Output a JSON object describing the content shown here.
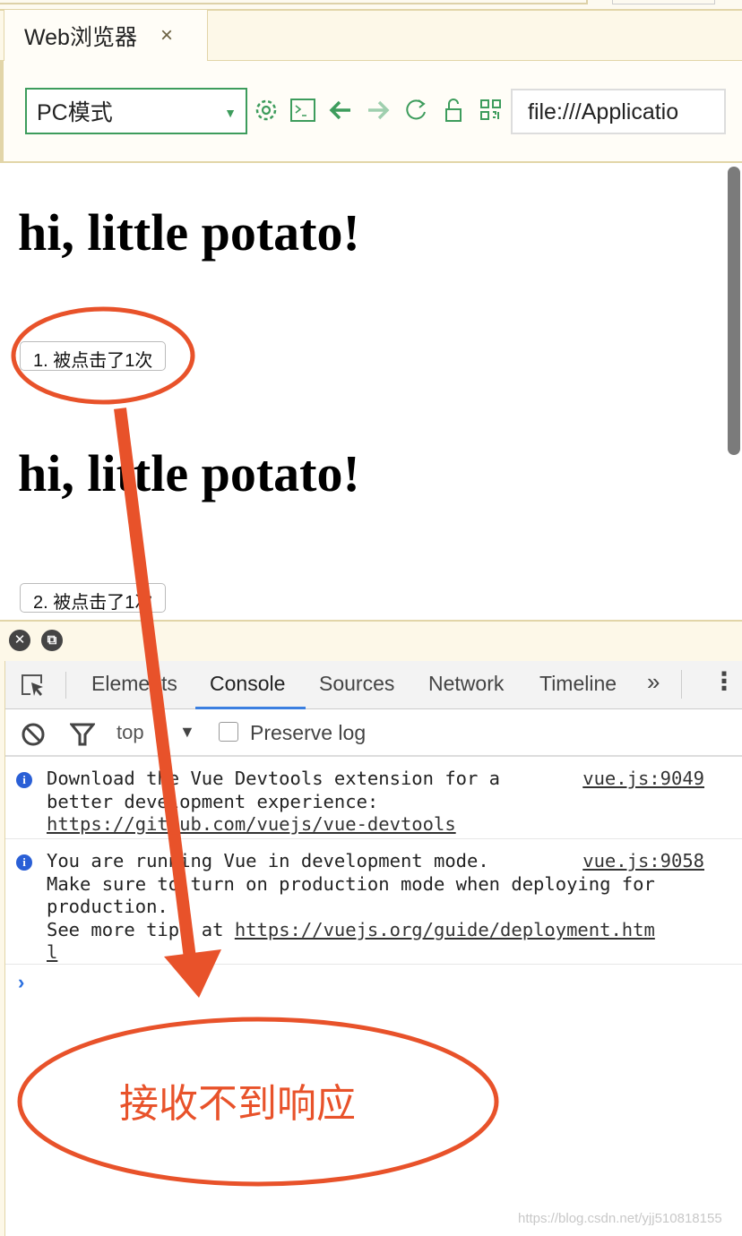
{
  "tab": {
    "title": "Web浏览器",
    "close": "×"
  },
  "toolbar": {
    "mode": "PC模式",
    "url": "file:///Applicatio"
  },
  "page": {
    "heading1": "hi, little potato!",
    "button1": "1. 被点击了1次",
    "heading2": "hi, little potato!",
    "button2": "2. 被点击了1次"
  },
  "devtools": {
    "tabs": [
      "Elements",
      "Console",
      "Sources",
      "Network",
      "Timeline"
    ],
    "more": "»",
    "context": "top",
    "preserve_log": "Preserve log",
    "messages": [
      {
        "lines": [
          "Download the Vue Devtools extension for a",
          "better development experience:"
        ],
        "link": "https://github.com/vuejs/vue-devtools",
        "source": "vue.js:9049"
      },
      {
        "lines": [
          "You are running Vue in development mode.",
          "Make sure to turn on production mode when deploying for",
          "production."
        ],
        "prefix": "See more tips at ",
        "link": "https://vuejs.org/guide/deployment.htm",
        "link2": "l",
        "source": "vue.js:9058"
      }
    ],
    "prompt": "›"
  },
  "annotation": {
    "note": "接收不到响应",
    "color": "#e8522a"
  },
  "watermark": "https://blog.csdn.net/yjj510818155"
}
